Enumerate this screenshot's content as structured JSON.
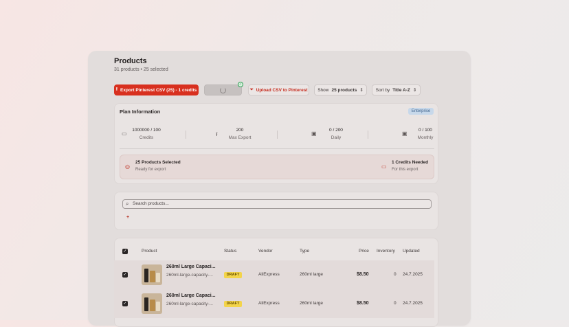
{
  "header": {
    "title": "Products",
    "subtitle": "31 products • 25 selected"
  },
  "toolbar": {
    "export_label": "Export Pinterest CSV (25) - 1 credits",
    "upload_label": "Upload CSV to Pinterest",
    "show_label": "Show",
    "show_value": "25 products",
    "sort_label": "Sort by",
    "sort_value": "Title A-Z"
  },
  "plan": {
    "title": "Plan Information",
    "badge": "Enterprise",
    "stats": [
      {
        "value": "1000000 / 100",
        "label": "Credits",
        "icon": "credit-card-icon"
      },
      {
        "value": "200",
        "label": "Max Export",
        "icon": "upload-icon"
      },
      {
        "value": "0 / 200",
        "label": "Daily",
        "icon": "calendar-icon"
      },
      {
        "value": "0 / 100",
        "label": "Monthly",
        "icon": "calendar-icon"
      }
    ],
    "selected_title": "25 Products Selected",
    "selected_sub": "Ready for export",
    "credits_title": "1 Credits Needed",
    "credits_sub": "For this export"
  },
  "search": {
    "placeholder": "Search products..."
  },
  "table": {
    "headers": [
      "Product",
      "Status",
      "Vendor",
      "Type",
      "Price",
      "Inventory",
      "Updated"
    ],
    "rows": [
      {
        "name": "260ml Large Capaci...",
        "handle": "260ml-large-capacity-...",
        "status": "DRAFT",
        "vendor": "AliExpress",
        "type": "260ml large",
        "price": "$8.50",
        "inventory": "0",
        "updated": "24.7.2025"
      },
      {
        "name": "260ml Large Capaci...",
        "handle": "260ml-large-capacity-...",
        "status": "DRAFT",
        "vendor": "AliExpress",
        "type": "260ml large",
        "price": "$8.50",
        "inventory": "0",
        "updated": "24.7.2025"
      }
    ]
  },
  "colors": {
    "accent": "#d8301f",
    "draft_badge": "#f3d44a",
    "plan_badge": "#c7d8ea"
  }
}
